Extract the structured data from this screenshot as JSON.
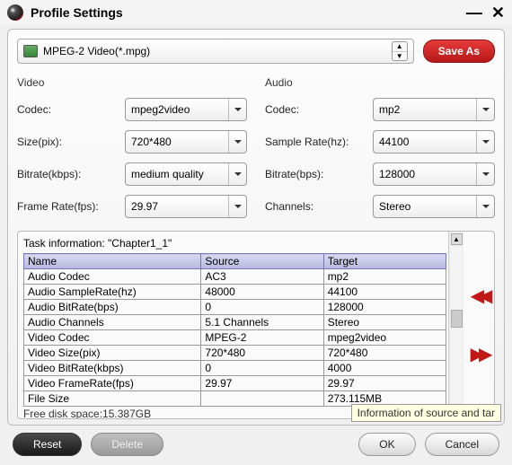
{
  "window": {
    "title": "Profile Settings"
  },
  "profile": {
    "selected": "MPEG-2 Video(*.mpg)",
    "save_as": "Save As"
  },
  "video": {
    "heading": "Video",
    "codec_label": "Codec:",
    "codec": "mpeg2video",
    "size_label": "Size(pix):",
    "size": "720*480",
    "bitrate_label": "Bitrate(kbps):",
    "bitrate": "medium quality",
    "framerate_label": "Frame Rate(fps):",
    "framerate": "29.97"
  },
  "audio": {
    "heading": "Audio",
    "codec_label": "Codec:",
    "codec": "mp2",
    "samplerate_label": "Sample Rate(hz):",
    "samplerate": "44100",
    "bitrate_label": "Bitrate(bps):",
    "bitrate": "128000",
    "channels_label": "Channels:",
    "channels": "Stereo"
  },
  "task": {
    "heading": "Task information: \"Chapter1_1\"",
    "columns": {
      "name": "Name",
      "source": "Source",
      "target": "Target"
    },
    "rows": [
      {
        "name": "Audio Codec",
        "source": "AC3",
        "target": "mp2"
      },
      {
        "name": "Audio SampleRate(hz)",
        "source": "48000",
        "target": "44100"
      },
      {
        "name": "Audio BitRate(bps)",
        "source": "0",
        "target": "128000"
      },
      {
        "name": "Audio Channels",
        "source": "5.1 Channels",
        "target": "Stereo"
      },
      {
        "name": "Video Codec",
        "source": "MPEG-2",
        "target": "mpeg2video"
      },
      {
        "name": "Video Size(pix)",
        "source": "720*480",
        "target": "720*480"
      },
      {
        "name": "Video BitRate(kbps)",
        "source": "0",
        "target": "4000"
      },
      {
        "name": "Video FrameRate(fps)",
        "source": "29.97",
        "target": "29.97"
      },
      {
        "name": "File Size",
        "source": "",
        "target": "273.115MB"
      }
    ],
    "free_disk": "Free disk space:15.387GB"
  },
  "tooltip": "Information of source and tar",
  "buttons": {
    "reset": "Reset",
    "delete": "Delete",
    "ok": "OK",
    "cancel": "Cancel"
  }
}
